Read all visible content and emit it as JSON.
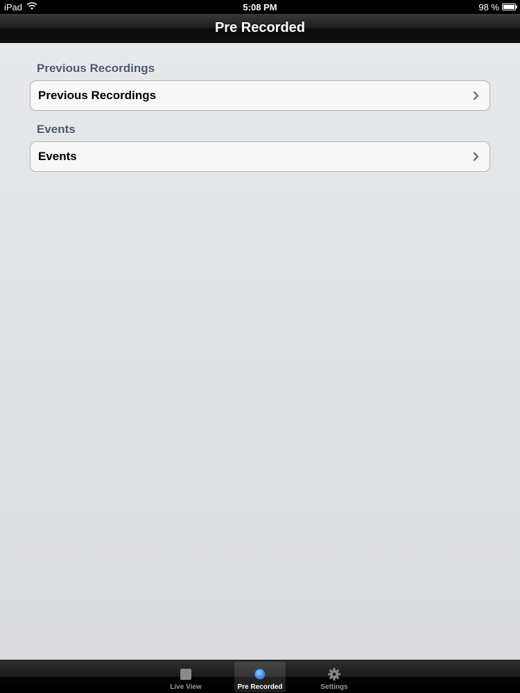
{
  "status_bar": {
    "device": "iPad",
    "time": "5:08 PM",
    "battery": "98 %",
    "battery_level": 0.98
  },
  "nav": {
    "title": "Pre Recorded"
  },
  "sections": [
    {
      "header": "Previous Recordings",
      "cell_label": "Previous Recordings"
    },
    {
      "header": "Events",
      "cell_label": "Events"
    }
  ],
  "tabs": [
    {
      "label": "Live View",
      "icon": "camera-square-icon",
      "selected": false
    },
    {
      "label": "Pre Recorded",
      "icon": "record-dot-icon",
      "selected": true
    },
    {
      "label": "Settings",
      "icon": "gear-icon",
      "selected": false
    }
  ],
  "colors": {
    "section_header": "#4c566c",
    "selected_tab_icon": "#3f8de0"
  }
}
